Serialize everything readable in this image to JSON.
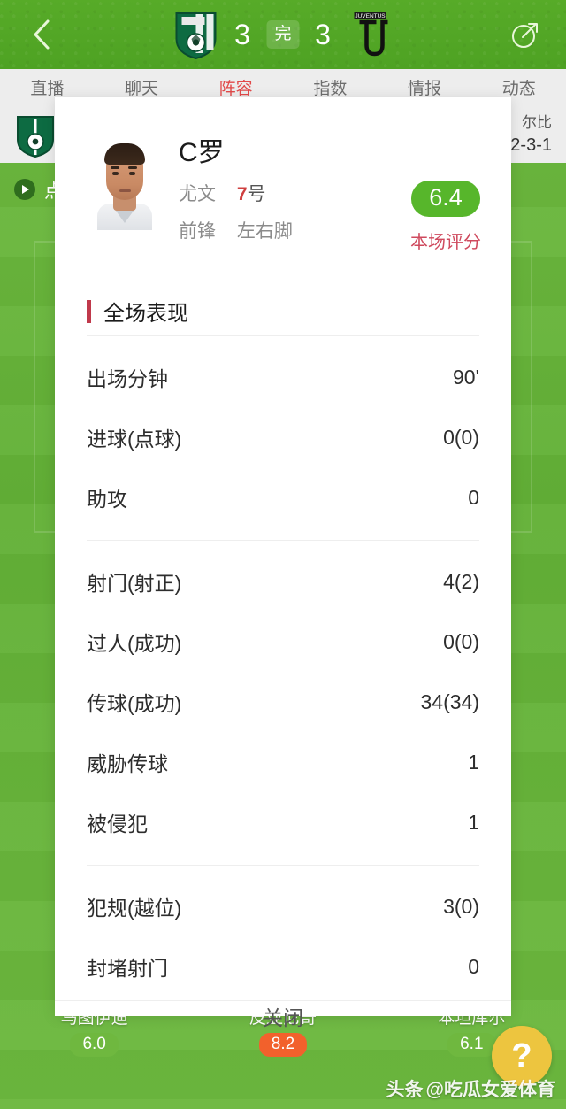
{
  "header": {
    "back_icon": "chevron-left-icon",
    "share_icon": "share-arrow-icon",
    "home_team": "萨索洛",
    "away_team": "尤文图斯",
    "home_score": "3",
    "away_score": "3",
    "status": "完"
  },
  "tabs": [
    {
      "label": "直播",
      "active": false
    },
    {
      "label": "聊天",
      "active": false
    },
    {
      "label": "阵容",
      "active": true
    },
    {
      "label": "指数",
      "active": false
    },
    {
      "label": "情报",
      "active": false
    },
    {
      "label": "动态",
      "active": false
    }
  ],
  "background": {
    "formation_label": "尔比",
    "formation_value": "2-3-1",
    "video_text": "点",
    "bench": [
      {
        "name": "马图伊迪",
        "rating": "6.0",
        "color": "#6fb83f"
      },
      {
        "name": "皮亚尼奇",
        "rating": "8.2",
        "color": "#f2612c"
      },
      {
        "name": "本坦库尔",
        "rating": "6.1",
        "color": "#6fb83f"
      }
    ],
    "help_label": "?",
    "watermark_prefix": "头条",
    "watermark_handle": "@吃瓜女爱体育"
  },
  "modal": {
    "player": {
      "name": "C罗",
      "team": "尤文",
      "number": "7",
      "number_suffix": "号",
      "position": "前锋",
      "foot": "左右脚",
      "rating": "6.4",
      "rating_label": "本场评分",
      "rating_color": "#57b62b"
    },
    "section_title": "全场表现",
    "stat_groups": [
      {
        "rows": [
          {
            "label": "出场分钟",
            "value": "90'"
          },
          {
            "label": "进球(点球)",
            "value": "0(0)"
          },
          {
            "label": "助攻",
            "value": "0"
          }
        ]
      },
      {
        "rows": [
          {
            "label": "射门(射正)",
            "value": "4(2)"
          },
          {
            "label": "过人(成功)",
            "value": "0(0)"
          },
          {
            "label": "传球(成功)",
            "value": "34(34)"
          },
          {
            "label": "威胁传球",
            "value": "1"
          },
          {
            "label": "被侵犯",
            "value": "1"
          }
        ]
      },
      {
        "rows": [
          {
            "label": "犯规(越位)",
            "value": "3(0)"
          },
          {
            "label": "封堵射门",
            "value": "0"
          }
        ]
      }
    ],
    "close_label": "关闭"
  }
}
